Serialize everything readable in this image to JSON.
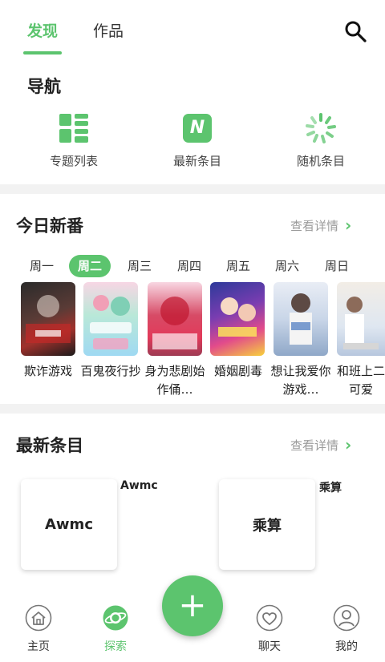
{
  "top_tabs": {
    "discover": "发现",
    "works": "作品"
  },
  "nav": {
    "title": "导航",
    "items": [
      {
        "label": "专题列表",
        "icon": "grid-list-icon"
      },
      {
        "label": "最新条目",
        "icon": "new-badge-icon",
        "badge": "N"
      },
      {
        "label": "随机条目",
        "icon": "spinner-icon"
      }
    ]
  },
  "today": {
    "title": "今日新番",
    "more": "查看详情",
    "days": [
      "周一",
      "周二",
      "周三",
      "周四",
      "周五",
      "周六",
      "周日"
    ],
    "active_day": "周二",
    "items": [
      {
        "title": "欺诈游戏"
      },
      {
        "title": "百鬼夜行抄"
      },
      {
        "title": "身为悲剧始作俑…"
      },
      {
        "title": "婚姻剧毒"
      },
      {
        "title": "想让我爱你游戏…"
      },
      {
        "title": "和班上二可爱"
      }
    ]
  },
  "latest": {
    "title": "最新条目",
    "more": "查看详情",
    "cards": [
      {
        "name": "Awmc",
        "caption": "Awmc"
      },
      {
        "name": "乘算",
        "caption": "乘算"
      }
    ]
  },
  "bottom_nav": {
    "items": [
      {
        "label": "主页",
        "icon": "home-icon"
      },
      {
        "label": "探索",
        "icon": "planet-icon",
        "active": true
      },
      {
        "label": "聊天",
        "icon": "heart-chat-icon"
      },
      {
        "label": "我的",
        "icon": "profile-icon"
      }
    ],
    "fab": "+"
  },
  "colors": {
    "accent": "#5cc46e",
    "muted": "#9a9a9a"
  }
}
